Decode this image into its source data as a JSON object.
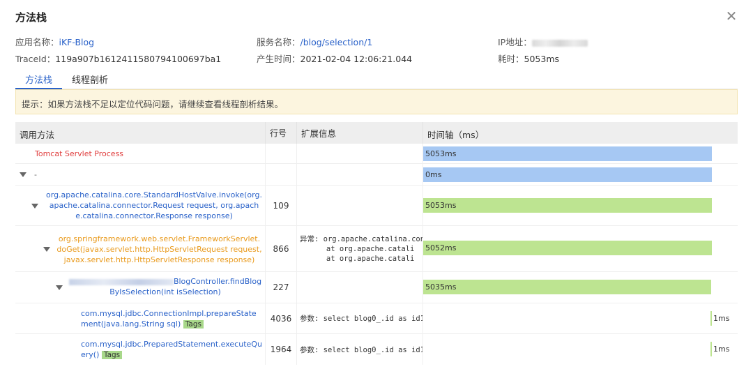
{
  "dialog": {
    "title": "方法栈"
  },
  "info": {
    "app_label": "应用名称：",
    "app_value": "iKF-Blog",
    "service_label": "服务名称：",
    "service_value": "/blog/selection/1",
    "ip_label": "IP地址：",
    "trace_label": "TraceId：",
    "trace_value": "119a907b1612411580794100697ba1",
    "time_label": "产生时间：",
    "time_value": "2021-02-04 12:06:21.044",
    "cost_label": "耗时：",
    "cost_value": "5053ms"
  },
  "tabs": [
    {
      "label": "方法栈",
      "active": true
    },
    {
      "label": "线程剖析",
      "active": false
    }
  ],
  "notice": "提示：如果方法栈不足以定位代码问题，请继续查看线程剖析结果。",
  "table": {
    "headers": [
      "调用方法",
      "行号",
      "扩展信息",
      "时间轴（ms）"
    ],
    "total_ms": 5053,
    "rows": [
      {
        "method": "Tomcat Servlet Process",
        "color": "#e03f3f",
        "line": "",
        "ext": "",
        "ms": 5053,
        "ms_label": "5053ms",
        "bar": "blue"
      },
      {
        "method": "-",
        "color": "#666666",
        "line": "",
        "ext": "",
        "ms": 0,
        "ms_label": "0ms",
        "bar": "blue"
      },
      {
        "method": "org.apache.catalina.core.StandardHostValve.invoke(org.apache.catalina.connector.Request request, org.apache.catalina.connector.Response response)",
        "color": "#2a62c9",
        "line": "109",
        "ext": "",
        "ms": 5053,
        "ms_label": "5053ms",
        "bar": "green"
      },
      {
        "method": "org.springframework.web.servlet.FrameworkServlet.doGet(javax.servlet.http.HttpServletRequest request, javax.servlet.http.HttpServletResponse response)",
        "color": "#e99a1c",
        "line": "866",
        "ext": "异常: org.apache.catalina.con\n      at org.apache.catali\n      at org.apache.catali",
        "ms": 5052,
        "ms_label": "5052ms",
        "bar": "green"
      },
      {
        "method": "BlogController.findBlogByIsSelection(int isSelection)",
        "color": "#2a62c9",
        "line": "227",
        "ext": "",
        "ms": 5035,
        "ms_label": "5035ms",
        "bar": "green"
      },
      {
        "method": "com.mysql.jdbc.ConnectionImpl.prepareStatement(java.lang.String sql)",
        "tag": "Tags",
        "color": "#2a62c9",
        "line": "4036",
        "ext": "参数: select blog0_.id as id1",
        "ms": 1,
        "ms_label": "1ms",
        "bar": "tick"
      },
      {
        "method": "com.mysql.jdbc.PreparedStatement.executeQuery()",
        "tag": "Tags",
        "color": "#2a62c9",
        "line": "1964",
        "ext": "参数: select blog0_.id as id1",
        "ms": 1,
        "ms_label": "1ms",
        "bar": "tick"
      }
    ]
  }
}
